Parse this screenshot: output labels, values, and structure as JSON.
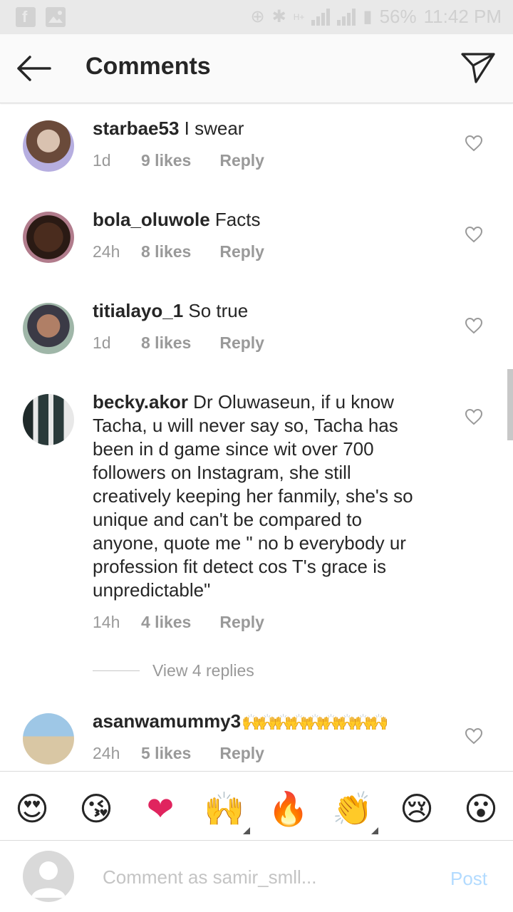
{
  "status_bar": {
    "battery": "56%",
    "time": "11:42 PM",
    "network": "H+"
  },
  "header": {
    "title": "Comments"
  },
  "comments": [
    {
      "username": "starbae53",
      "text": " I swear",
      "time": "1d",
      "likes": "9 likes",
      "reply": "Reply"
    },
    {
      "username": "bola_oluwole",
      "text": " Facts",
      "time": "24h",
      "likes": "8 likes",
      "reply": "Reply"
    },
    {
      "username": "titialayo_1",
      "text": " So true",
      "time": "1d",
      "likes": "8 likes",
      "reply": "Reply"
    },
    {
      "username": "becky.akor",
      "text": " Dr Oluwaseun, if u know Tacha, u will never say so, Tacha has been in d game since wit over 700 followers on Instagram, she still creatively keeping her fanmily, she's so unique and can't be compared to anyone, quote me \" no b everybody ur profession fit detect cos T's grace is unpredictable\"",
      "time": "14h",
      "likes": "4 likes",
      "reply": "Reply",
      "view_replies": "View 4 replies"
    },
    {
      "username": "asanwamummy3",
      "text": " 🙌🙌🙌🙌🙌🙌🙌🙌🙌",
      "time": "24h",
      "likes": "5 likes",
      "reply": "Reply"
    }
  ],
  "emoji_bar": [
    "😍",
    "😘",
    "❤",
    "🙌",
    "🔥",
    "👏",
    "😢",
    "😮"
  ],
  "composer": {
    "placeholder": "Comment as samir_smll...",
    "post_label": "Post"
  }
}
